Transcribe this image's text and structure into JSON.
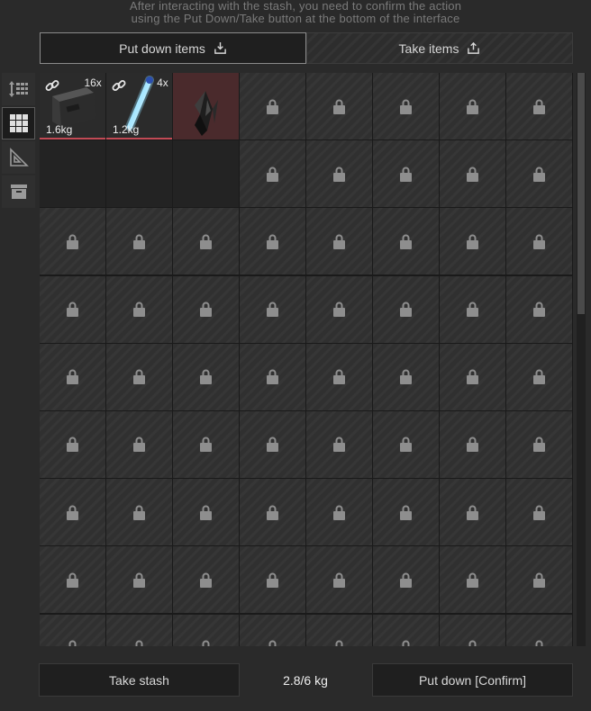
{
  "hint": {
    "line1": "After interacting with the stash, you need to confirm the action",
    "line2": "using the Put Down/Take button at the bottom of the interface"
  },
  "tabs": {
    "put_down": "Put down items",
    "take": "Take items"
  },
  "side_tools": [
    {
      "icon": "sort-icon"
    },
    {
      "icon": "grid-icon",
      "active": true
    },
    {
      "icon": "ruler-triangle-icon"
    },
    {
      "icon": "storage-box-icon"
    }
  ],
  "items": [
    {
      "qty": "16x",
      "weight": "1.6kg",
      "icon": "ammo-box-icon"
    },
    {
      "qty": "4x",
      "weight": "1.2kg",
      "icon": "glow-stick-icon"
    },
    {
      "icon": "crystal-artifact-icon"
    }
  ],
  "footer": {
    "take_stash": "Take stash",
    "weight": "2.8/6 kg",
    "put_down_confirm": "Put down [Confirm]"
  },
  "colors": {
    "background": "#2a2a2a",
    "item_highlight": "#4a2a2c",
    "weight_bar": "#c24a55"
  }
}
